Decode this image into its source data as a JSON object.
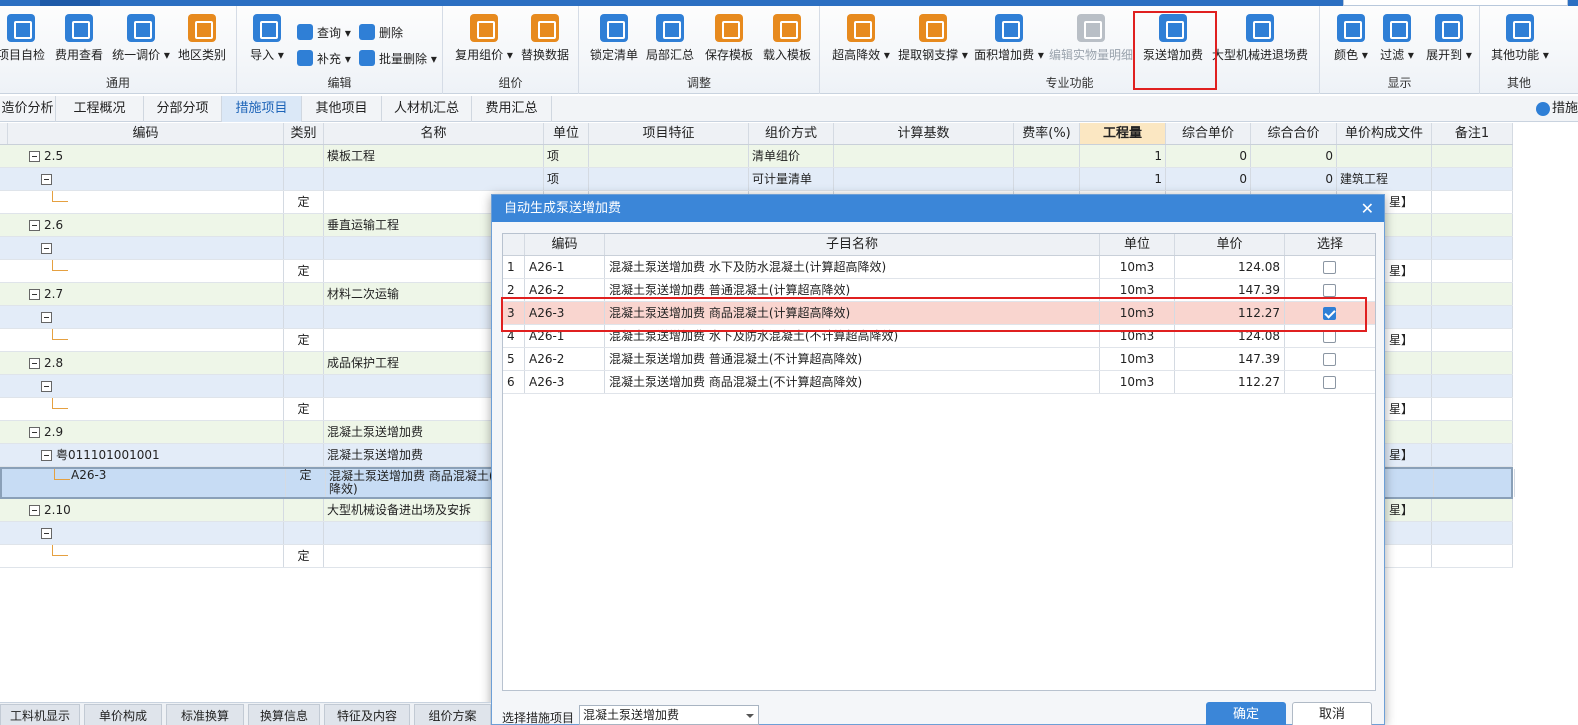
{
  "ribbon": {
    "groups": [
      {
        "label": "通用",
        "buttons": [
          "项目自检",
          "费用查看",
          "统一调价 ▾",
          "地区类别"
        ]
      },
      {
        "label": "编辑",
        "buttons": [
          "导入 ▾"
        ],
        "small": [
          "查询 ▾",
          "删除",
          "补充 ▾",
          "批量删除 ▾"
        ]
      },
      {
        "label": "组价",
        "buttons": [
          "复用组价 ▾",
          "替换数据"
        ]
      },
      {
        "label": "调整",
        "buttons": [
          "锁定清单",
          "局部汇总",
          "保存模板",
          "载入模板"
        ]
      },
      {
        "label": "专业功能",
        "buttons": [
          "超高降效 ▾",
          "提取钢支撑 ▾",
          "面积增加费 ▾",
          "编辑实物量明细",
          "泵送增加费",
          "大型机械进退场费"
        ]
      },
      {
        "label": "显示",
        "buttons": [
          "颜色 ▾",
          "过滤 ▾",
          "展开到 ▾"
        ]
      },
      {
        "label": "其他",
        "buttons": [
          "其他功能 ▾"
        ]
      }
    ]
  },
  "tabs": [
    "造价分析",
    "工程概况",
    "分部分项",
    "措施项目",
    "其他项目",
    "人材机汇总",
    "费用汇总"
  ],
  "tab_right": "措施",
  "grid": {
    "headers": [
      "编码",
      "类别",
      "名称",
      "单位",
      "项目特征",
      "组价方式",
      "计算基数",
      "费率(%)",
      "工程量",
      "综合单价",
      "综合合价",
      "单价构成文件",
      "备注1"
    ],
    "rows": [
      {
        "code": "2.5",
        "type": "",
        "name": "模板工程",
        "unit": "项",
        "method": "清单组价",
        "qty": "1",
        "price": "0",
        "total": "0",
        "file": ""
      },
      {
        "code": "",
        "type": "",
        "name": "",
        "unit": "项",
        "method": "可计量清单",
        "qty": "1",
        "price": "0",
        "total": "0",
        "file": "建筑工程"
      },
      {
        "code": "",
        "type": "定",
        "name": "",
        "unit": "",
        "method": "",
        "qty": "",
        "price": "",
        "total": "",
        "file": ""
      },
      {
        "code": "2.6",
        "type": "",
        "name": "垂直运输工程",
        "unit": "",
        "method": "",
        "qty": "",
        "price": "",
        "total": "",
        "file": ""
      },
      {
        "code": "",
        "type": "",
        "name": "",
        "unit": "",
        "method": "",
        "qty": "",
        "price": "",
        "total": "",
        "file": ""
      },
      {
        "code": "",
        "type": "定",
        "name": "",
        "unit": "",
        "method": "",
        "qty": "",
        "price": "",
        "total": "",
        "file": ""
      },
      {
        "code": "2.7",
        "type": "",
        "name": "材料二次运输",
        "unit": "",
        "method": "",
        "qty": "",
        "price": "",
        "total": "",
        "file": ""
      },
      {
        "code": "",
        "type": "",
        "name": "",
        "unit": "",
        "method": "",
        "qty": "",
        "price": "",
        "total": "",
        "file": ""
      },
      {
        "code": "",
        "type": "定",
        "name": "",
        "unit": "",
        "method": "",
        "qty": "",
        "price": "",
        "total": "",
        "file": ""
      },
      {
        "code": "2.8",
        "type": "",
        "name": "成品保护工程",
        "unit": "",
        "method": "",
        "qty": "",
        "price": "",
        "total": "",
        "file": ""
      },
      {
        "code": "",
        "type": "",
        "name": "",
        "unit": "",
        "method": "",
        "qty": "",
        "price": "",
        "total": "",
        "file": ""
      },
      {
        "code": "",
        "type": "定",
        "name": "",
        "unit": "",
        "method": "",
        "qty": "",
        "price": "",
        "total": "",
        "file": ""
      },
      {
        "code": "2.9",
        "type": "",
        "name": "混凝土泵送增加费",
        "unit": "",
        "method": "",
        "qty": "",
        "price": "",
        "total": "",
        "file": ""
      },
      {
        "code": "粤011101001001",
        "type": "",
        "name": "混凝土泵送增加费",
        "unit": "",
        "method": "",
        "qty": "",
        "price": "",
        "total": "",
        "file": ""
      },
      {
        "code": "A26-3",
        "type": "定",
        "name": "混凝土泵送增加费 商品混凝土(",
        "name2": "降效)",
        "unit": "",
        "method": "",
        "qty": "",
        "price": "",
        "total": "",
        "file": ""
      },
      {
        "code": "2.10",
        "type": "",
        "name": "大型机械设备进出场及安拆",
        "unit": "",
        "method": "",
        "qty": "",
        "price": "",
        "total": "",
        "file": ""
      },
      {
        "code": "",
        "type": "",
        "name": "",
        "unit": "",
        "method": "",
        "qty": "",
        "price": "",
        "total": "",
        "file": ""
      },
      {
        "code": "",
        "type": "定",
        "name": "",
        "unit": "",
        "method": "",
        "qty": "",
        "price": "",
        "total": "",
        "file": ""
      }
    ],
    "right_fragments": [
      "星】",
      "",
      "",
      "星】",
      "",
      "",
      "星】",
      "",
      "",
      "星】",
      "",
      "星】",
      "",
      "星】"
    ]
  },
  "dialog": {
    "title": "自动生成泵送增加费",
    "headers": [
      "",
      "编码",
      "子目名称",
      "单位",
      "单价",
      "选择"
    ],
    "rows": [
      {
        "n": "1",
        "code": "A26-1",
        "name": "混凝土泵送增加费 水下及防水混凝土(计算超高降效)",
        "unit": "10m3",
        "price": "124.08",
        "checked": false
      },
      {
        "n": "2",
        "code": "A26-2",
        "name": "混凝土泵送增加费 普通混凝土(计算超高降效)",
        "unit": "10m3",
        "price": "147.39",
        "checked": false
      },
      {
        "n": "3",
        "code": "A26-3",
        "name": "混凝土泵送增加费 商品混凝土(计算超高降效)",
        "unit": "10m3",
        "price": "112.27",
        "checked": true
      },
      {
        "n": "4",
        "code": "A26-1",
        "name": "混凝土泵送增加费 水下及防水混凝土(不计算超高降效)",
        "unit": "10m3",
        "price": "124.08",
        "checked": false
      },
      {
        "n": "5",
        "code": "A26-2",
        "name": "混凝土泵送增加费 普通混凝土(不计算超高降效)",
        "unit": "10m3",
        "price": "147.39",
        "checked": false
      },
      {
        "n": "6",
        "code": "A26-3",
        "name": "混凝土泵送增加费 商品混凝土(不计算超高降效)",
        "unit": "10m3",
        "price": "112.27",
        "checked": false
      }
    ],
    "footer_label": "选择措施项目",
    "select_value": "混凝土泵送增加费",
    "ok": "确定",
    "cancel": "取消"
  },
  "bottom_tabs": [
    "工料机显示",
    "单价构成",
    "标准换算",
    "换算信息",
    "特征及内容",
    "组价方案"
  ],
  "colors": {
    "accent": "#3b86d8",
    "highlight": "#e02020"
  }
}
